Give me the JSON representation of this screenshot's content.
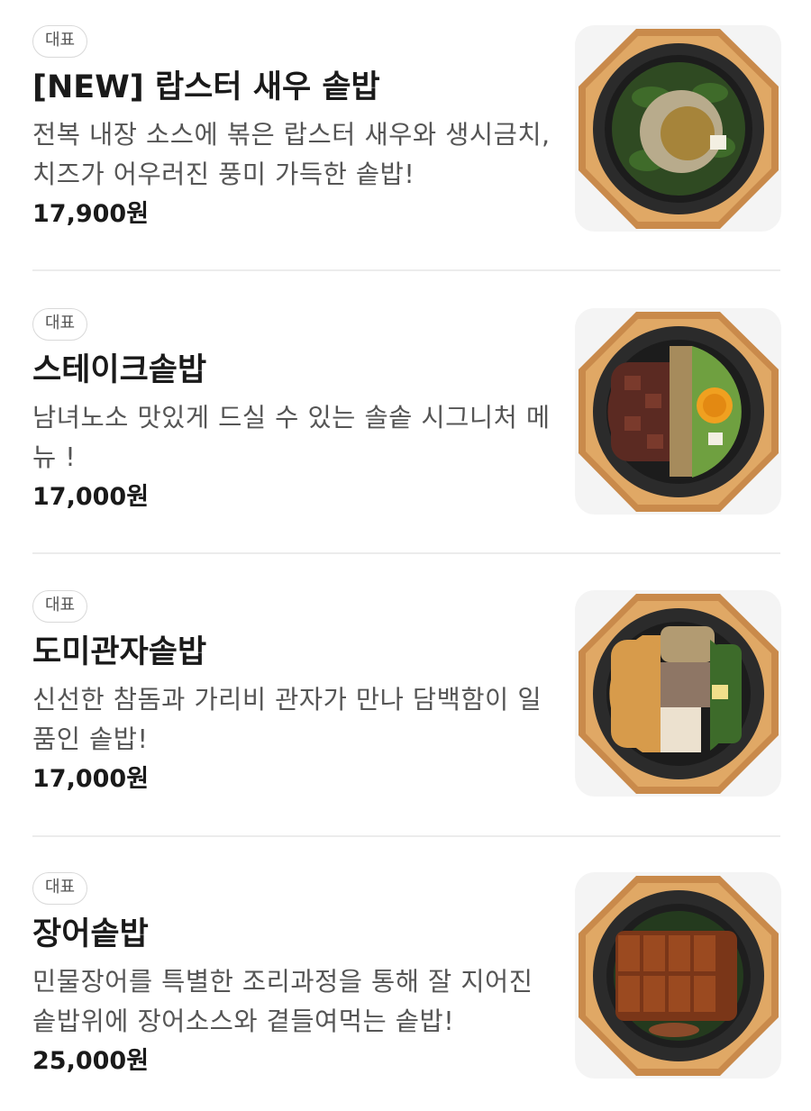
{
  "menu": {
    "items": [
      {
        "badge": "대표",
        "name": "[NEW] 랍스터 새우 솥밥",
        "description": "전복 내장 소스에 볶은 랍스터 새우와 생시금치, 치즈가 어우러진 풍미 가득한 솥밥!",
        "price": "17,900원",
        "image": "lobster-shrimp-sotbap-photo"
      },
      {
        "badge": "대표",
        "name": "스테이크솥밥",
        "description": "남녀노소 맛있게 드실 수 있는 솔솥 시그니처 메뉴 !",
        "price": "17,000원",
        "image": "steak-sotbap-photo"
      },
      {
        "badge": "대표",
        "name": "도미관자솥밥",
        "description": "신선한 참돔과 가리비 관자가 만나 담백함이 일품인 솥밥!",
        "price": "17,000원",
        "image": "sea-bream-scallop-sotbap-photo"
      },
      {
        "badge": "대표",
        "name": "장어솥밥",
        "description": "민물장어를 특별한 조리과정을 통해 잘 지어진 솥밥위에 장어소스와 곁들여먹는 솥밥!",
        "price": "25,000원",
        "image": "eel-sotbap-photo"
      }
    ]
  },
  "colors": {
    "wood_board": "#c98a4b",
    "wood_edge": "#e0a865",
    "pot": "#2b2b2b",
    "badge_border": "#d9d9d9",
    "divider": "#ececec"
  }
}
